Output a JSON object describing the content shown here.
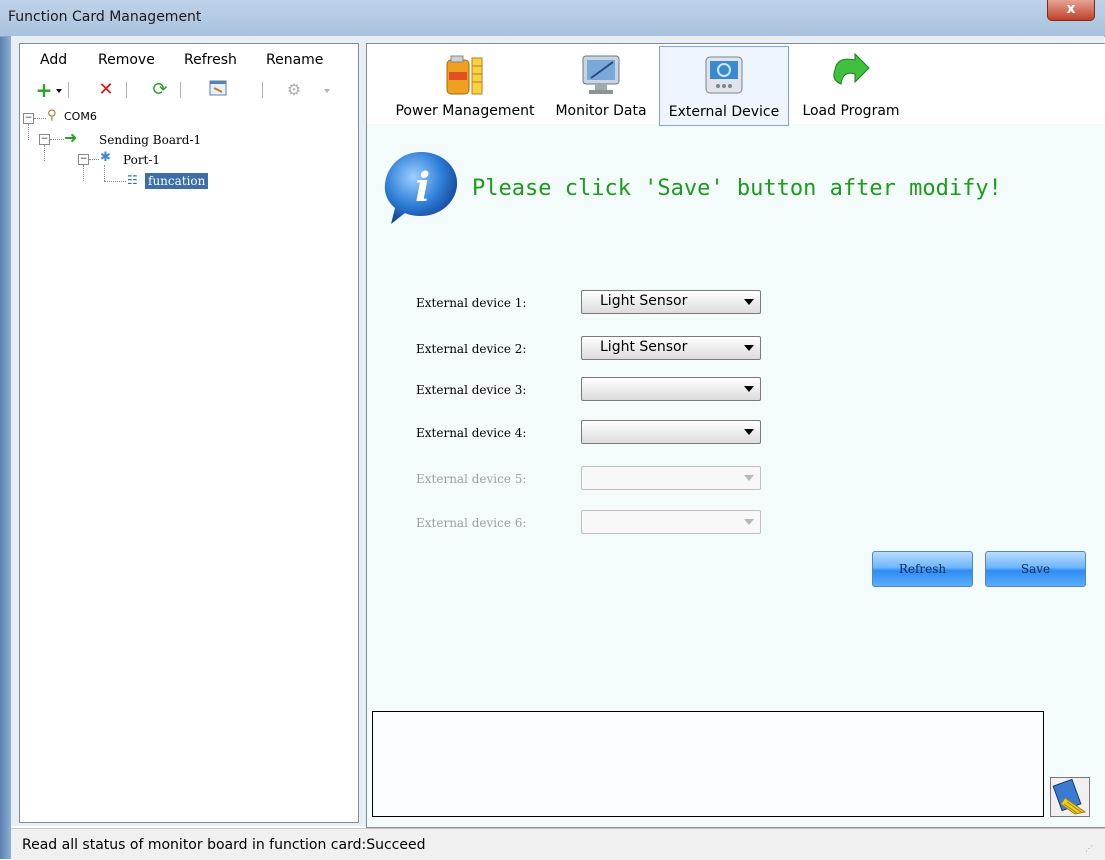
{
  "window": {
    "title": "Function Card Management",
    "close_label": "x"
  },
  "left_menu": {
    "add": "Add",
    "remove": "Remove",
    "refresh": "Refresh",
    "rename": "Rename"
  },
  "tree": {
    "com": "COM6",
    "board": "Sending Board-1",
    "port": "Port-1",
    "func": "funcation"
  },
  "tabs": [
    {
      "label": "Power Management"
    },
    {
      "label": "Monitor Data"
    },
    {
      "label": "External Device"
    },
    {
      "label": "Load Program"
    }
  ],
  "message": "Please click 'Save' button after modify!",
  "devices": [
    {
      "label": "External device 1:",
      "value": "Light Sensor",
      "enabled": true
    },
    {
      "label": "External device 2:",
      "value": "Light Sensor",
      "enabled": true
    },
    {
      "label": "External device 3:",
      "value": "",
      "enabled": true
    },
    {
      "label": "External device 4:",
      "value": "",
      "enabled": true
    },
    {
      "label": "External device 5:",
      "value": "",
      "enabled": false
    },
    {
      "label": "External device 6:",
      "value": "",
      "enabled": false
    }
  ],
  "buttons": {
    "refresh": "Refresh",
    "save": "Save"
  },
  "status": "Read all status of monitor board in function card:Succeed",
  "colors": {
    "message": "#1d9b1d",
    "selection": "#3d6ea8",
    "button": "#2f8cf2"
  }
}
